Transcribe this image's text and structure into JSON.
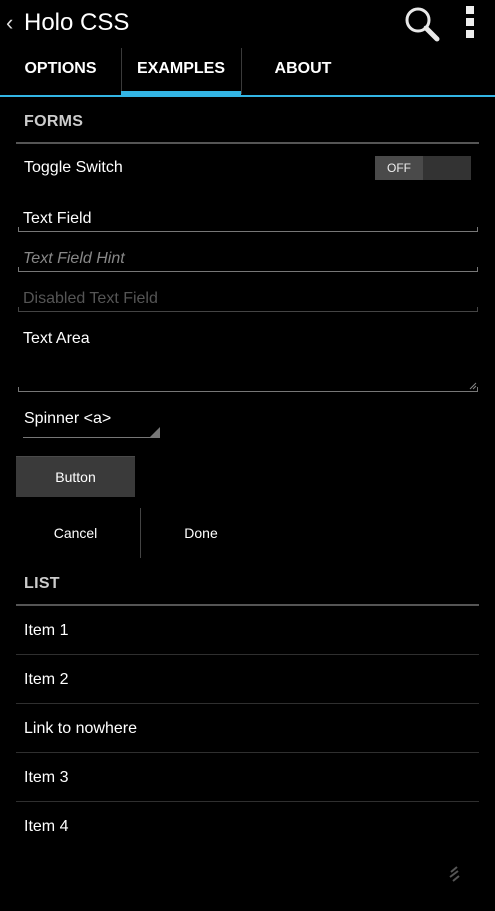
{
  "action_bar": {
    "back_glyph": "‹",
    "title": "Holo CSS",
    "icons": [
      "search-icon",
      "overflow-menu-icon"
    ]
  },
  "tabs": [
    {
      "label": "OPTIONS",
      "selected": false
    },
    {
      "label": "EXAMPLES",
      "selected": true
    },
    {
      "label": "ABOUT",
      "selected": false
    }
  ],
  "forms": {
    "header": "FORMS",
    "toggle": {
      "label": "Toggle Switch",
      "state": "OFF"
    },
    "text_field": {
      "value": "Text Field"
    },
    "hint_field": {
      "placeholder": "Text Field Hint"
    },
    "disabled_field": {
      "placeholder": "Disabled Text Field"
    },
    "text_area": {
      "value": "Text Area"
    },
    "spinner": {
      "label": "Spinner <a>"
    },
    "button": {
      "label": "Button"
    },
    "button_bar": {
      "cancel": "Cancel",
      "done": "Done"
    }
  },
  "list": {
    "header": "LIST",
    "items": [
      "Item 1",
      "Item 2",
      "Link to nowhere",
      "Item 3",
      "Item 4"
    ]
  },
  "colors": {
    "accent": "#33b5e5",
    "background": "#000000"
  }
}
